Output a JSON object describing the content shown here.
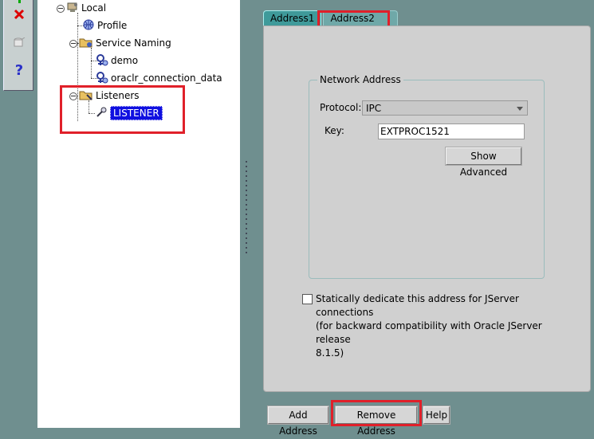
{
  "toolbar": {
    "icons": [
      "plus-icon",
      "delete-icon",
      "database-icon",
      "help-icon"
    ],
    "help_glyph": "?"
  },
  "tree": {
    "root": "Local",
    "profile": "Profile",
    "service_naming": "Service Naming",
    "services": [
      "demo",
      "oraclr_connection_data"
    ],
    "listeners": "Listeners",
    "listener": "LISTENER"
  },
  "tabs": [
    {
      "label": "Address1",
      "active": true
    },
    {
      "label": "Address2",
      "active": false
    }
  ],
  "network_address": {
    "title": "Network Address",
    "protocol_label": "Protocol:",
    "protocol_value": "IPC",
    "key_label": "Key:",
    "key_value": "EXTPROC1521",
    "show_advanced": "Show Advanced"
  },
  "jserver": {
    "checked": false,
    "lines": [
      "Statically dedicate this address for JServer connections",
      "(for backward compatibility with Oracle JServer release",
      "8.1.5)"
    ]
  },
  "buttons": {
    "add_address": "Add Address",
    "remove_address": "Remove Address",
    "help": "Help"
  },
  "colors": {
    "background": "#6f8f8f",
    "tab_active": "#3f9a9a",
    "selection": "#1010e0",
    "highlight": "#e0202a"
  }
}
